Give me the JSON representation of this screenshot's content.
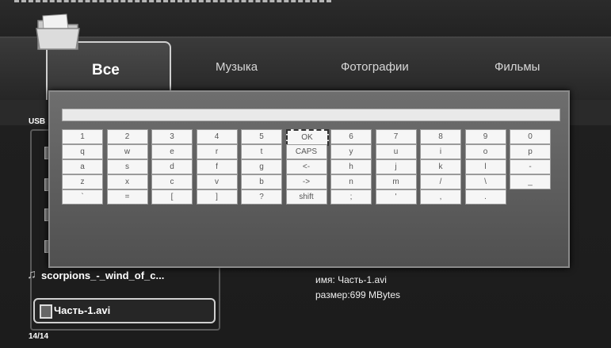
{
  "tabs": {
    "all": "Все",
    "music": "Музыка",
    "photos": "Фотографии",
    "films": "Фильмы"
  },
  "source_label": "USB",
  "files": {
    "music_item": "scorpions_-_wind_of_c...",
    "selected_item": "Часть-1.avi",
    "count": "14/14"
  },
  "info": {
    "name": "имя: Часть-1.avi",
    "size": "размер:699 MBytes"
  },
  "keyboard": {
    "rows": [
      [
        "1",
        "2",
        "3",
        "4",
        "5",
        "OK",
        "6",
        "7",
        "8",
        "9",
        "0"
      ],
      [
        "q",
        "w",
        "e",
        "r",
        "t",
        "CAPS",
        "y",
        "u",
        "i",
        "o",
        "p"
      ],
      [
        "a",
        "s",
        "d",
        "f",
        "g",
        "<-",
        "h",
        "j",
        "k",
        "l",
        "-"
      ],
      [
        "z",
        "x",
        "c",
        "v",
        "b",
        "->",
        "n",
        "m",
        "/",
        "\\",
        "_"
      ],
      [
        "`",
        "=",
        "[",
        "]",
        "?",
        "shift",
        ";",
        "'",
        ",",
        "."
      ]
    ],
    "input_value": ""
  },
  "icons": {
    "folder": "folder-icon",
    "music": "music-note-icon",
    "video_file": "video-file-icon"
  }
}
